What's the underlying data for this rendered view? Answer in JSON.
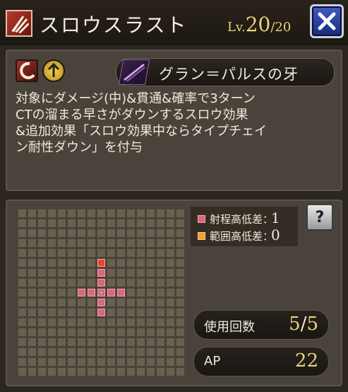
{
  "header": {
    "skill_name": "スロウスラスト",
    "level_prefix": "Lv.",
    "level_current": "20",
    "level_max": "/20"
  },
  "weapon": {
    "name": "グラン＝パルスの牙",
    "icon": "weapon-fang-icon"
  },
  "element_icons": [
    "slash-element-icon",
    "up-arrow-icon"
  ],
  "description": "対象にダメージ(中)&貫通&確率で3ターン\nCTの溜まる早さがダウンするスロウ効果\n&追加効果「スロウ効果中ならタイプチェイ\nン耐性ダウン」を付与",
  "legend": {
    "range_height_label": "射程高低差：",
    "range_height_value": "1",
    "area_height_label": "範囲高低差：",
    "area_height_value": "0"
  },
  "stats": {
    "uses_label": "使用回数",
    "uses_current": "5",
    "uses_max": "5",
    "ap_label": "AP",
    "ap_value": "22"
  },
  "colors": {
    "range": "#d46a7a",
    "area": "#f0a030",
    "accent": "#e9d37a"
  }
}
